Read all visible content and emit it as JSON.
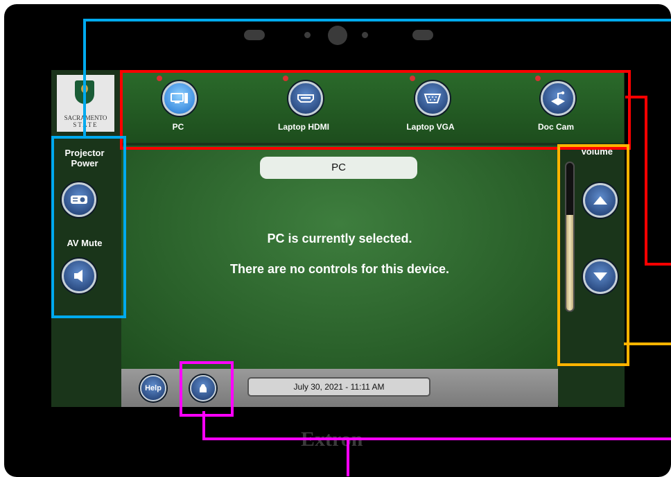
{
  "logo": {
    "line1": "SACRAMENTO",
    "line2": "STATE"
  },
  "sources": [
    {
      "label": "PC",
      "icon": "monitor-icon",
      "active": true
    },
    {
      "label": "Laptop HDMI",
      "icon": "hdmi-icon",
      "active": false
    },
    {
      "label": "Laptop VGA",
      "icon": "vga-icon",
      "active": false
    },
    {
      "label": "Doc Cam",
      "icon": "document-camera-icon",
      "active": false
    }
  ],
  "left_panel": {
    "projector_power_label": "Projector\nPower",
    "av_mute_label": "AV Mute"
  },
  "main": {
    "source_title": "PC",
    "message_line1": "PC is currently selected.",
    "message_line2": "There are no controls for this device."
  },
  "volume": {
    "label": "Volume",
    "level_fraction": 0.65
  },
  "footer": {
    "help_label": "Help",
    "datetime": "July 30, 2021  -  11:11 AM"
  },
  "brand": "Extron",
  "colors": {
    "highlight_source_bar": "#ff0000",
    "highlight_left_panel": "#00aaee",
    "highlight_volume": "#ffb400",
    "highlight_footer_button": "#ff00ff"
  }
}
